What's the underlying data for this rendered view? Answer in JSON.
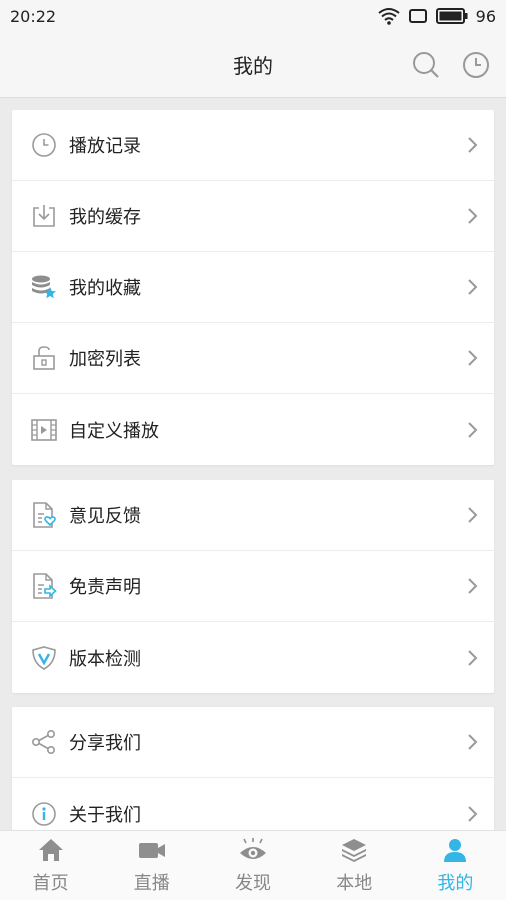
{
  "status_bar": {
    "time": "20:22",
    "battery": "96"
  },
  "header": {
    "title": "我的"
  },
  "groups": [
    {
      "items": [
        {
          "label": "播放记录",
          "icon": "clock-icon"
        },
        {
          "label": "我的缓存",
          "icon": "download-icon"
        },
        {
          "label": "我的收藏",
          "icon": "database-star-icon"
        },
        {
          "label": "加密列表",
          "icon": "lock-icon"
        },
        {
          "label": "自定义播放",
          "icon": "film-play-icon"
        }
      ]
    },
    {
      "items": [
        {
          "label": "意见反馈",
          "icon": "feedback-doc-icon"
        },
        {
          "label": "免责声明",
          "icon": "disclaimer-doc-icon"
        },
        {
          "label": "版本检测",
          "icon": "shield-v-icon"
        }
      ]
    },
    {
      "items": [
        {
          "label": "分享我们",
          "icon": "share-icon"
        },
        {
          "label": "关于我们",
          "icon": "info-icon"
        }
      ]
    }
  ],
  "tabs": [
    {
      "label": "首页",
      "icon": "home-icon",
      "active": false
    },
    {
      "label": "直播",
      "icon": "camera-icon",
      "active": false
    },
    {
      "label": "发现",
      "icon": "eye-icon",
      "active": false
    },
    {
      "label": "本地",
      "icon": "layers-icon",
      "active": false
    },
    {
      "label": "我的",
      "icon": "user-icon",
      "active": true
    }
  ],
  "colors": {
    "accent": "#33b5e5",
    "icon_gray": "#9a9a9a",
    "background": "#ebebeb"
  }
}
